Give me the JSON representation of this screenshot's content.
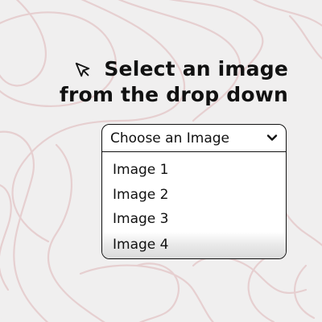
{
  "heading": {
    "line1": "Select an image",
    "line2": "from the drop down"
  },
  "icons": {
    "cursor": "cursor-arrow-icon",
    "chevron": "chevron-down-icon"
  },
  "dropdown": {
    "placeholder": "Choose an Image",
    "options": [
      "Image 1",
      "Image 2",
      "Image 3",
      "Image 4"
    ],
    "hovered_option": "Image 4"
  },
  "colors": {
    "background": "#f0efef",
    "contour_lines": "#e6cfd0",
    "text": "#111111",
    "dropdown_bg": "#ffffff"
  }
}
